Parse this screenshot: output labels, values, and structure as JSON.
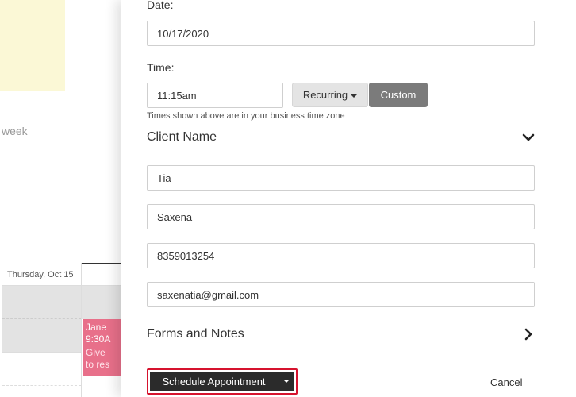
{
  "background_calendar": {
    "week_label": "week",
    "day_header": "Thursday, Oct 15",
    "appointment": {
      "name": "Jane",
      "time": "9:30A",
      "desc_line1": "Give",
      "desc_line2": "to res"
    }
  },
  "form": {
    "date_label": "Date:",
    "date_value": "10/17/2020",
    "time_label": "Time:",
    "time_value": "11:15am",
    "recurring_label": "Recurring",
    "custom_label": "Custom",
    "timezone_note": "Times shown above are in your business time zone",
    "client_section_title": "Client Name",
    "first_name": "Tia",
    "last_name": "Saxena",
    "phone": "8359013254",
    "email": "saxenatia@gmail.com",
    "forms_section_title": "Forms and Notes"
  },
  "footer": {
    "schedule_label": "Schedule Appointment",
    "cancel_label": "Cancel"
  },
  "colors": {
    "appointment": "#e8708a",
    "primary_button": "#2b2b2b",
    "highlight_border": "#d6132e",
    "custom_button": "#7b7b7b"
  },
  "icons": {
    "client_toggle": "chevron-down-icon",
    "forms_toggle": "chevron-right-icon",
    "schedule_dropdown": "caret-down-icon",
    "recurring_dropdown": "caret-down-icon"
  }
}
